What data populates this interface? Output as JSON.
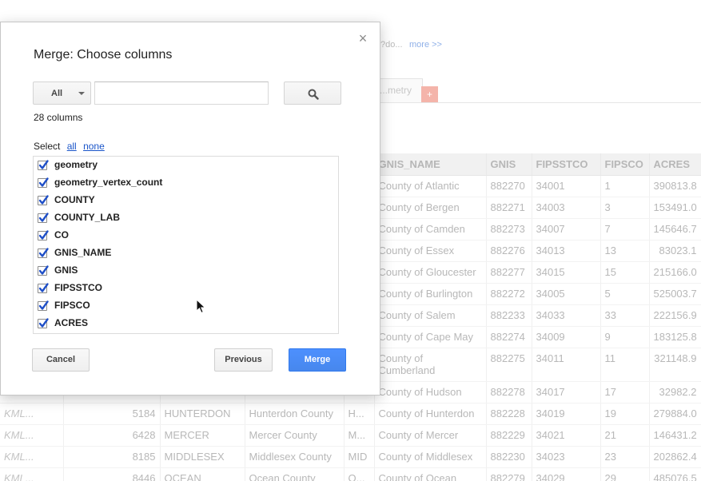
{
  "background": {
    "description_snippet": "?do...",
    "more_link": "more >>",
    "tab_label": "...metry",
    "add_tab_label": "+",
    "table": {
      "columns": [
        "",
        "",
        "",
        "",
        "",
        "GNIS_NAME",
        "GNIS",
        "FIPSSTCO",
        "FIPSCO",
        "ACRES"
      ],
      "rows": [
        [
          "",
          "",
          "",
          "",
          "",
          "County of Atlantic",
          "882270",
          "34001",
          "1",
          "390813.8"
        ],
        [
          "",
          "",
          "",
          "",
          "",
          "County of Bergen",
          "882271",
          "34003",
          "3",
          "153491.0"
        ],
        [
          "",
          "",
          "",
          "",
          "",
          "County of Camden",
          "882273",
          "34007",
          "7",
          "145646.7"
        ],
        [
          "",
          "",
          "",
          "",
          "",
          "County of Essex",
          "882276",
          "34013",
          "13",
          "83023.1"
        ],
        [
          "",
          "",
          "",
          "",
          "",
          "County of Gloucester",
          "882277",
          "34015",
          "15",
          "215166.0"
        ],
        [
          "",
          "",
          "",
          "",
          "",
          "County of Burlington",
          "882272",
          "34005",
          "5",
          "525003.7"
        ],
        [
          "",
          "",
          "",
          "",
          "",
          "County of Salem",
          "882233",
          "34033",
          "33",
          "222156.9"
        ],
        [
          "",
          "",
          "",
          "",
          "",
          "County of Cape May",
          "882274",
          "34009",
          "9",
          "183125.8"
        ],
        [
          "",
          "",
          "",
          "",
          "",
          "County of Cumberland",
          "882275",
          "34011",
          "11",
          "321148.9"
        ],
        [
          "",
          "",
          "",
          "",
          "",
          "County of Hudson",
          "882278",
          "34017",
          "17",
          "32982.2"
        ],
        [
          "KML...",
          "5184",
          "HUNTERDON",
          "Hunterdon County",
          "H...",
          "County of Hunterdon",
          "882228",
          "34019",
          "19",
          "279884.0"
        ],
        [
          "KML...",
          "6428",
          "MERCER",
          "Mercer County",
          "M...",
          "County of Mercer",
          "882229",
          "34021",
          "21",
          "146431.2"
        ],
        [
          "KML...",
          "8185",
          "MIDDLESEX",
          "Middlesex County",
          "MID",
          "County of Middlesex",
          "882230",
          "34023",
          "23",
          "202862.4"
        ],
        [
          "KML...",
          "8446",
          "OCEAN",
          "Ocean County",
          "O...",
          "County of Ocean",
          "882279",
          "34029",
          "29",
          "485076.5"
        ]
      ]
    }
  },
  "dialog": {
    "title": "Merge: Choose columns",
    "close_label": "×",
    "filter": {
      "selected": "All"
    },
    "search": {
      "value": "",
      "placeholder": ""
    },
    "column_count": "28 columns",
    "select_label": "Select",
    "select_all": "all",
    "select_none": "none",
    "columns": [
      {
        "name": "geometry",
        "checked": true
      },
      {
        "name": "geometry_vertex_count",
        "checked": true
      },
      {
        "name": "COUNTY",
        "checked": true
      },
      {
        "name": "COUNTY_LAB",
        "checked": true
      },
      {
        "name": "CO",
        "checked": true
      },
      {
        "name": "GNIS_NAME",
        "checked": true
      },
      {
        "name": "GNIS",
        "checked": true
      },
      {
        "name": "FIPSSTCO",
        "checked": true
      },
      {
        "name": "FIPSCO",
        "checked": true
      },
      {
        "name": "ACRES",
        "checked": true
      }
    ],
    "buttons": {
      "cancel": "Cancel",
      "previous": "Previous",
      "merge": "Merge"
    }
  },
  "icons": {
    "close": "close-icon",
    "search": "magnifier-icon",
    "checkbox": "checkmark-icon",
    "cursor": "mouse-pointer-icon",
    "dropdown": "caret-down-icon"
  },
  "colors": {
    "primary_button": "#4d90fe",
    "link": "#1a55c9",
    "checkmark": "#1f4fc7",
    "add_tab": "#f4b4aa"
  }
}
